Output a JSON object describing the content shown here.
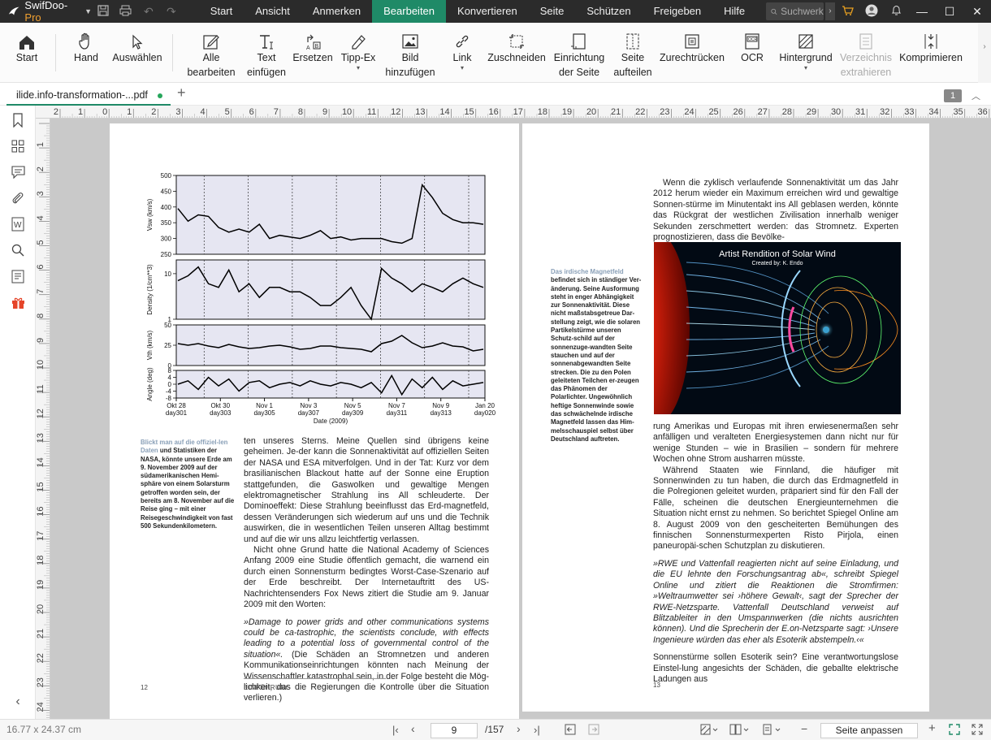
{
  "app": {
    "brand_name": "SwifDoo-",
    "brand_suffix": "Pro",
    "menu": [
      "Start",
      "Ansicht",
      "Anmerken",
      "Bearbeiten",
      "Konvertieren",
      "Seite",
      "Schützen",
      "Freigeben",
      "Hilfe"
    ],
    "active_menu": "Bearbeiten",
    "search_placeholder": "Suchwerk",
    "accent": "#1f8a67"
  },
  "ribbon": {
    "start": "Start",
    "hand": "Hand",
    "select": "Auswählen",
    "edit_all_1": "Alle",
    "edit_all_2": "bearbeiten",
    "add_text_1": "Text",
    "add_text_2": "einfügen",
    "replace": "Ersetzen",
    "typo": "Tipp-Ex",
    "add_image_1": "Bild",
    "add_image_2": "hinzufügen",
    "link": "Link",
    "crop": "Zuschneiden",
    "page_setup_1": "Einrichtung",
    "page_setup_2": "der Seite",
    "split_1": "Seite",
    "split_2": "aufteilen",
    "deskew": "Zurechtrücken",
    "ocr": "OCR",
    "background": "Hintergrund",
    "extract_1": "Verzeichnis",
    "extract_2": "extrahieren",
    "compress": "Komprimieren"
  },
  "document": {
    "tab_name": "ilide.info-transformation-...pdf",
    "page_badge": "1"
  },
  "rulers": {
    "h_labels": [
      "2",
      "1",
      "0",
      "1",
      "2",
      "3",
      "4",
      "5",
      "6",
      "7",
      "8",
      "9",
      "10",
      "11",
      "12",
      "13",
      "14",
      "15",
      "16",
      "17",
      "18",
      "19",
      "20",
      "21",
      "22",
      "23",
      "24",
      "25",
      "26",
      "27",
      "28",
      "29",
      "30",
      "31",
      "32",
      "33",
      "34",
      "35",
      "36"
    ],
    "v_labels": [
      "1",
      "2",
      "3",
      "4",
      "5",
      "6",
      "7",
      "8",
      "9",
      "10",
      "11",
      "12",
      "13",
      "14",
      "15",
      "16",
      "17",
      "18",
      "19",
      "20",
      "21",
      "22",
      "23",
      "24"
    ]
  },
  "left_page": {
    "chart_panels": {
      "vsw": {
        "label": "Vsw (km/s)",
        "ticks": [
          "500",
          "450",
          "400",
          "350",
          "300",
          "250"
        ]
      },
      "density": {
        "label": "Density (1/cm**3)",
        "ticks": [
          "10",
          "1"
        ]
      },
      "vth": {
        "label": "Vth (km/s)",
        "ticks": [
          "50",
          "25",
          "0"
        ]
      },
      "angle": {
        "label": "Angle (deg)",
        "ticks": [
          "8",
          "4",
          "0",
          "-4",
          "-8"
        ]
      }
    },
    "chart_data": {
      "type": "line",
      "title": "",
      "xlabel": "Date (2009)",
      "categories": [
        "Okt 28 day301",
        "Okt 30 day303",
        "Nov 1 day305",
        "Nov 3 day307",
        "Nov 5 day309",
        "Nov 7 day311",
        "Nov 9 day313",
        "Jan 20 day020"
      ],
      "series": [
        {
          "values": [
            395,
            355,
            375,
            370,
            335,
            320,
            330,
            320,
            345,
            300,
            310,
            305,
            300,
            310,
            325,
            300,
            305,
            295,
            300,
            300,
            300,
            290,
            285,
            300,
            470,
            430,
            380,
            360,
            350,
            350,
            345
          ]
        },
        {
          "values": [
            7,
            9,
            14,
            6,
            5,
            12,
            4,
            6,
            3,
            5,
            5,
            4,
            4,
            3,
            2,
            2,
            3,
            5,
            2,
            1,
            13,
            8,
            6,
            4,
            6,
            5,
            4,
            6,
            8,
            6,
            5
          ]
        },
        {
          "values": [
            27,
            25,
            27,
            24,
            22,
            26,
            23,
            21,
            22,
            24,
            25,
            23,
            20,
            21,
            24,
            24,
            22,
            21,
            20,
            17,
            27,
            30,
            37,
            28,
            22,
            24,
            28,
            24,
            23,
            18,
            20
          ]
        },
        {
          "values": [
            0,
            2,
            -3,
            4,
            -1,
            3,
            -4,
            1,
            2,
            -2,
            0,
            1,
            -1,
            2,
            0,
            -1,
            1,
            0,
            -2,
            1,
            -5,
            5,
            -6,
            3,
            -2,
            4,
            -3,
            2,
            -1,
            0,
            1
          ]
        }
      ],
      "ylim_vsw": [
        250,
        500
      ],
      "ylim_density": [
        1,
        20
      ],
      "ylim_vth": [
        0,
        50
      ],
      "ylim_angle": [
        -8,
        8
      ]
    },
    "x_ticks": [
      {
        "top": "Okt 28",
        "bot": "day301"
      },
      {
        "top": "Okt 30",
        "bot": "day303"
      },
      {
        "top": "Nov 1",
        "bot": "day305"
      },
      {
        "top": "Nov 3",
        "bot": "day307"
      },
      {
        "top": "Nov 5",
        "bot": "day309"
      },
      {
        "top": "Nov 7",
        "bot": "day311"
      },
      {
        "top": "Nov 9",
        "bot": "day313"
      },
      {
        "top": "Jan 20",
        "bot": "day020"
      }
    ],
    "x_title": "Date (2009)",
    "caption_hl": "Blickt man auf die offiziel-len Daten",
    "caption_rest": " und Statistiken der NASA, könnte unsere Erde am 9. November 2009 auf der südamerikanischen Hemi-sphäre von einem Solarsturm getroffen worden sein, der bereits am 8. November auf die Reise ging – mit einer Reisegeschwindigkeit von fast 500 Sekundenkilometern.",
    "body_p1": "ten unseres Sterns. Meine Quellen sind übrigens keine geheimen. Je-der kann die Sonnenaktivität auf offiziellen Seiten der NASA und ESA mitverfolgen. Und in der Tat: Kurz vor dem brasilianischen Blackout hatte auf der Sonne eine Eruption stattgefunden, die Gaswolken und gewaltige Mengen elektromagnetischer Strahlung ins All schleuderte. Der Dominoeffekt: Diese Strahlung beeinflusst das Erd-magnetfeld, dessen Veränderungen sich wiederum auf uns und die Technik auswirken, die in wesentlichen Teilen unseren Alltag bestimmt und auf die wir uns allzu leichtfertig verlassen.",
    "body_p2": "Nicht ohne Grund hatte die National Academy of Sciences Anfang 2009 eine Studie öffentlich gemacht, die warnend ein durch einen Sonnensturm bedingtes Worst-Case-Szenario auf der Erde beschreibt. Der Internetauftritt des US-Nachrichtensenders Fox News zitiert die Studie am 9. Januar 2009 mit den Worten:",
    "quote": "»Damage to power grids and other communications systems could be ca-tastrophic, the scientists conclude, with effects leading to a potential loss of governmental control of the situation«.",
    "body_p3": " (Die Schäden an Stromnetzen und anderen Kommunikationseinrichtungen könnten nach Meinung der Wissenschaftler katastrophal sein, in der Folge besteht die Mög-lichkeit, das die Regierungen die Kontrolle über die Situation verlieren.)",
    "page_number": "12",
    "footer": "EINFÜHRUNG"
  },
  "right_page": {
    "top_text": "Wenn die zyklisch verlaufende Sonnenaktivität um das Jahr 2012 herum wieder ein Maximum erreichen wird und gewaltige Sonnen-stürme im Minutentakt ins All geblasen werden, könnte das Rückgrat der westlichen Zivilisation innerhalb weniger Sekunden zerschmettert werden: das Stromnetz. Experten prognostizieren, dass die Bevölke-",
    "image_title": "Artist Rendition of Solar Wind",
    "image_credit": "Created by: K. Endo",
    "caption_hl": "Das irdische Magnetfeld",
    "caption_rest": " befindet sich in ständiger Ver-änderung. Seine Ausformung steht in enger Abhängigkeit zur Sonnenaktivität. Diese nicht maßstabsgetreue Dar-stellung zeigt, wie die solaren Partikelstürme unseren Schutz-schild auf der sonnenzuge-wandten Seite stauchen und auf der sonnenabgewandten Seite strecken. Die zu den Polen geleiteten Teilchen er-zeugen das Phänomen der Polarlichter. Ungewöhnlich heftige Sonnenwinde sowie das schwächelnde irdische Magnetfeld lassen das Him-melsschauspiel selbst über Deutschland auftreten.",
    "body_p1": "rung Amerikas und Europas mit ihren erwiesenermaßen sehr anfälligen und veralteten Energiesystemen dann nicht nur für wenige Stunden – wie in Brasilien – sondern für mehrere Wochen ohne Strom ausharren müsste.",
    "body_p2": "Während Staaten wie Finnland, die häufiger mit Sonnenwinden zu tun haben, die durch das Erdmagnetfeld in die Polregionen geleitet wurden, präpariert sind für den Fall der Fälle, scheinen die deutschen Energieunternehmen die Situation nicht ernst zu nehmen. So berichtet Spiegel Online am 8. August 2009 von den gescheiterten Bemühungen des finnischen Sonnensturmexperten Risto Pirjola, einen paneuropäi-schen Schutzplan zu diskutieren.",
    "quote": "»RWE und Vattenfall reagierten nicht auf seine Einladung, und die EU lehnte den Forschungsantrag ab«, schreibt Spiegel Online und zitiert die Reaktionen die Stromfirmen: »Weltraumwetter sei ›höhere Gewalt‹, sagt der Sprecher der RWE-Netzsparte. Vattenfall Deutschland verweist auf Blitzableiter in den Umspannwerken (die nichts ausrichten können). Und die Sprecherin der E.on-Netzsparte sagt: ›Unsere Ingenieure würden das eher als Esoterik abstempeln.‹«",
    "body_p3": "Sonnenstürme sollen Esoterik sein? Eine verantwortungslose Einstel-lung angesichts der Schäden, die geballte elektrische Ladungen aus",
    "page_number": "13"
  },
  "status": {
    "dimensions": "16.77 x 24.37 cm",
    "current_page": "9",
    "total_pages": "/157",
    "zoom_mode": "Seite anpassen"
  }
}
